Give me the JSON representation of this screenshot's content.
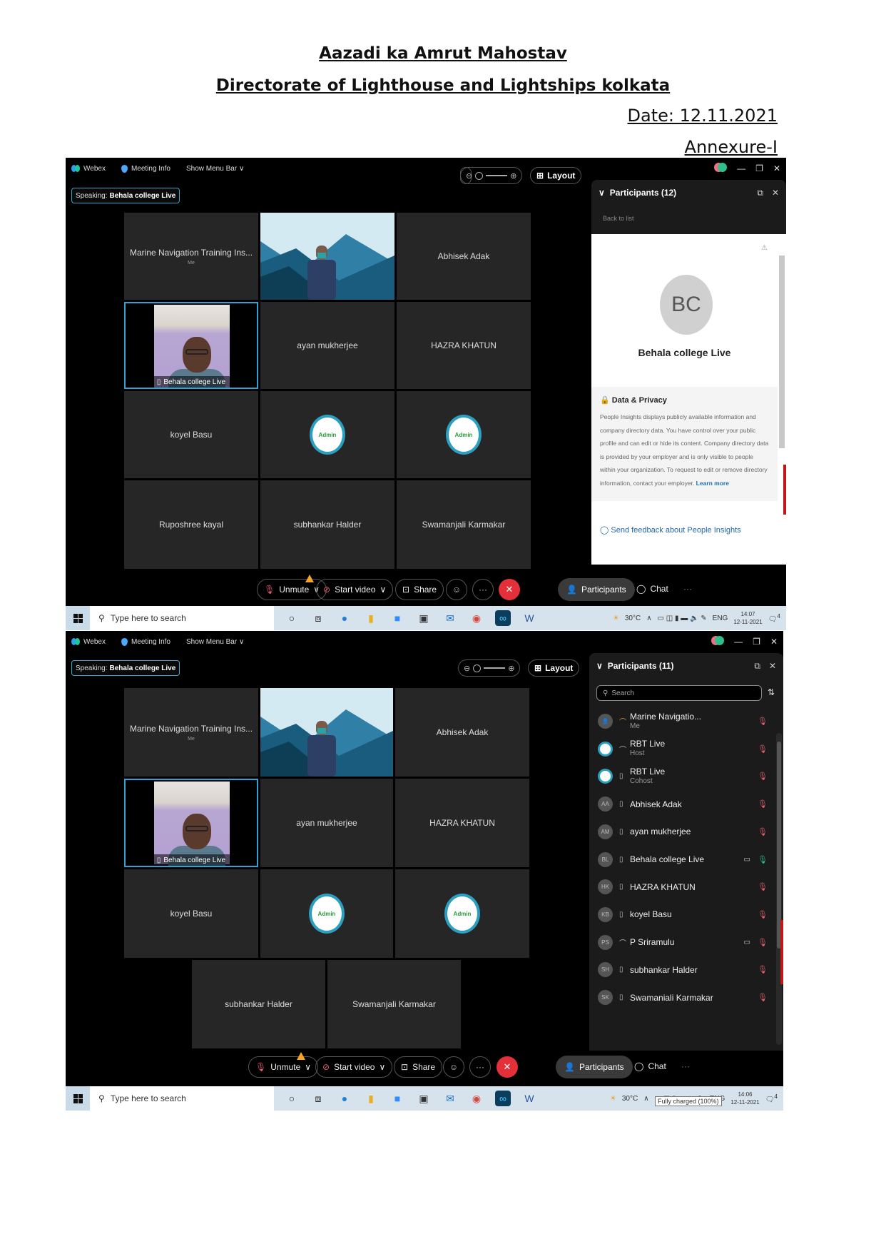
{
  "document": {
    "title": "Aazadi ka Amrut Mahostav",
    "subtitle": "Directorate of Lighthouse and Lightships kolkata",
    "date": "Date: 12.11.2021",
    "annexure": "Annexure-I"
  },
  "screenshots": [
    {
      "titlebar": {
        "app": "Webex",
        "meeting_info": "Meeting Info",
        "menu": "Show Menu Bar"
      },
      "speaking": {
        "label": "Speaking:",
        "name": "Behala college Live"
      },
      "layout_label": "Layout",
      "tiles": [
        {
          "name": "Marine Navigation Training Ins...",
          "sub": "Me",
          "type": "name"
        },
        {
          "name": "",
          "type": "video-mountain"
        },
        {
          "name": "Abhisek Adak",
          "type": "name"
        },
        {
          "name": "Behala college Live",
          "type": "video-person",
          "active": true
        },
        {
          "name": "ayan mukherjee",
          "type": "name"
        },
        {
          "name": "HAZRA KHATUN",
          "type": "name"
        },
        {
          "name": "koyel Basu",
          "type": "name"
        },
        {
          "name": "Admin",
          "type": "admin-logo"
        },
        {
          "name": "Admin",
          "type": "admin-logo"
        },
        {
          "name": "Ruposhree kayal",
          "type": "name"
        },
        {
          "name": "subhankar Halder",
          "type": "name"
        },
        {
          "name": "Swamanjali Karmakar",
          "type": "name"
        }
      ],
      "panel": {
        "title": "Participants (12)",
        "back": "Back to list",
        "initials": "BC",
        "profile_name": "Behala college Live",
        "privacy_title": "Data & Privacy",
        "privacy_text": "People Insights displays publicly available information and company directory data. You have control over your public profile and can edit or hide its content. Company directory data is provided by your employer and is only visible to people within your organization. To request to edit or remove directory information, contact your employer.",
        "learn_more": "Learn more",
        "feedback": "Send feedback about People Insights"
      },
      "controls": {
        "unmute": "Unmute",
        "start_video": "Start video",
        "share": "Share",
        "participants": "Participants",
        "chat": "Chat"
      },
      "taskbar": {
        "search_placeholder": "Type here to search",
        "temp": "30°C",
        "lang": "ENG",
        "time": "14:07",
        "date": "12-11-2021",
        "notifications": "4"
      }
    },
    {
      "titlebar": {
        "app": "Webex",
        "meeting_info": "Meeting Info",
        "menu": "Show Menu Bar"
      },
      "speaking": {
        "label": "Speaking:",
        "name": "Behala college Live"
      },
      "layout_label": "Layout",
      "tiles": [
        {
          "name": "Marine Navigation Training Ins...",
          "sub": "Me",
          "type": "name"
        },
        {
          "name": "",
          "type": "video-mountain"
        },
        {
          "name": "Abhisek Adak",
          "type": "name"
        },
        {
          "name": "Behala college Live",
          "type": "video-person",
          "active": true
        },
        {
          "name": "ayan mukherjee",
          "type": "name"
        },
        {
          "name": "HAZRA KHATUN",
          "type": "name"
        },
        {
          "name": "koyel Basu",
          "type": "name"
        },
        {
          "name": "Admin",
          "type": "admin-logo"
        },
        {
          "name": "Admin",
          "type": "admin-logo"
        },
        {
          "name": "subhankar Halder",
          "type": "name"
        },
        {
          "name": "Swamanjali Karmakar",
          "type": "name"
        }
      ],
      "panel": {
        "title": "Participants (11)",
        "search_placeholder": "Search",
        "participants": [
          {
            "initials": "",
            "name": "Marine Navigatio...",
            "role": "Me",
            "device": "headset",
            "video": false,
            "mic": "muted"
          },
          {
            "initials": "",
            "name": "RBT Live",
            "role": "Host",
            "device": "headset",
            "video": false,
            "mic": "muted",
            "admin": true
          },
          {
            "initials": "",
            "name": "RBT Live",
            "role": "Cohost",
            "device": "phone",
            "video": false,
            "mic": "muted",
            "admin": true
          },
          {
            "initials": "AA",
            "name": "Abhisek Adak",
            "role": "",
            "device": "phone",
            "video": false,
            "mic": "muted"
          },
          {
            "initials": "AM",
            "name": "ayan mukherjee",
            "role": "",
            "device": "phone",
            "video": false,
            "mic": "muted"
          },
          {
            "initials": "BL",
            "name": "Behala college Live",
            "role": "",
            "device": "phone",
            "video": true,
            "mic": "on"
          },
          {
            "initials": "HK",
            "name": "HAZRA KHATUN",
            "role": "",
            "device": "phone",
            "video": false,
            "mic": "muted"
          },
          {
            "initials": "KB",
            "name": "koyel Basu",
            "role": "",
            "device": "phone",
            "video": false,
            "mic": "muted"
          },
          {
            "initials": "PS",
            "name": "P Sriramulu",
            "role": "",
            "device": "headset",
            "video": true,
            "mic": "muted"
          },
          {
            "initials": "SH",
            "name": "subhankar Halder",
            "role": "",
            "device": "phone",
            "video": false,
            "mic": "muted"
          },
          {
            "initials": "SK",
            "name": "Swamaniali Karmakar",
            "role": "",
            "device": "phone",
            "video": false,
            "mic": "muted"
          }
        ]
      },
      "controls": {
        "unmute": "Unmute",
        "start_video": "Start video",
        "share": "Share",
        "participants": "Participants",
        "chat": "Chat"
      },
      "taskbar": {
        "search_placeholder": "Type here to search",
        "temp": "30°C",
        "lang": "ENG",
        "time": "14:06",
        "date": "12-11-2021",
        "notifications": "4",
        "tooltip": "Fully charged (100%)"
      }
    }
  ],
  "icons": {
    "minimize": "—",
    "restore": "❐",
    "close": "✕",
    "chevron": "∨",
    "popout": "⧉",
    "mic_off": "🎙",
    "more": "···",
    "end": "✕",
    "search": "⚲",
    "sort": "⇅",
    "phone": "▯",
    "headset": "⌒",
    "video": "▭",
    "lock": "🔒",
    "feedback": "◯"
  }
}
